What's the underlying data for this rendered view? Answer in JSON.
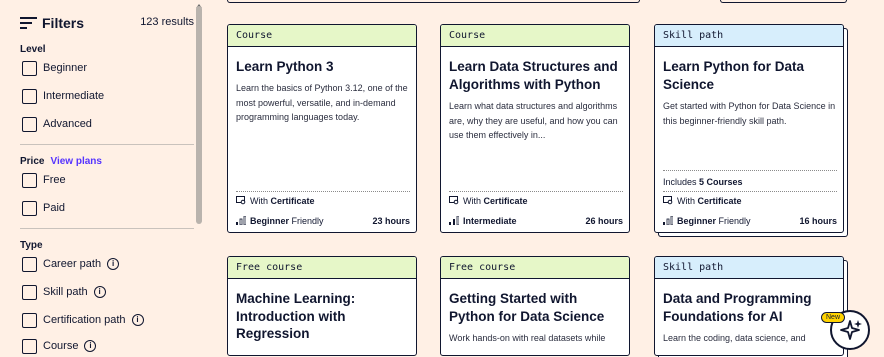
{
  "sidebar": {
    "title": "Filters",
    "results": "123 results",
    "groups": {
      "level": {
        "title": "Level",
        "options": [
          "Beginner",
          "Intermediate",
          "Advanced"
        ]
      },
      "price": {
        "title": "Price",
        "link": "View plans",
        "options": [
          "Free",
          "Paid"
        ]
      },
      "type": {
        "title": "Type",
        "options": [
          "Career path",
          "Skill path",
          "Certification path",
          "Course"
        ]
      }
    }
  },
  "cards": [
    {
      "tag": "Course",
      "title": "Learn Python 3",
      "desc": "Learn the basics of Python 3.12, one of the most powerful, versatile, and in-demand programming languages today.",
      "cert_prefix": "With ",
      "cert": "Certificate",
      "level_strong": "Beginner",
      "level_rest": " Friendly",
      "hours": "23 hours"
    },
    {
      "tag": "Course",
      "title": "Learn Data Structures and Algorithms with Python",
      "desc": "Learn what data structures and algorithms are, why they are useful, and how you can use them effectively in...",
      "cert_prefix": "With ",
      "cert": "Certificate",
      "level_strong": "Intermediate",
      "level_rest": "",
      "hours": "26 hours"
    },
    {
      "tag": "Skill path",
      "title": "Learn Python for Data Science",
      "desc": "Get started with Python for Data Science in this beginner-friendly skill path.",
      "includes_prefix": "Includes ",
      "includes": "5 Courses",
      "cert_prefix": "With ",
      "cert": "Certificate",
      "level_strong": "Beginner",
      "level_rest": " Friendly",
      "hours": "16 hours"
    },
    {
      "tag": "Free course",
      "title": "Machine Learning: Introduction with Regression"
    },
    {
      "tag": "Free course",
      "title": "Getting Started with Python for Data Science",
      "desc": "Work hands-on with real datasets while"
    },
    {
      "tag": "Skill path",
      "title": "Data and Programming Foundations for AI",
      "desc": "Learn the coding, data science, and"
    }
  ],
  "badge": {
    "label": "New"
  },
  "colors": {
    "background": "#fff0e5",
    "course_tag": "#e6f7c8",
    "skill_tag": "#d7eefc",
    "link": "#5533ff",
    "badge": "#ffd300"
  }
}
